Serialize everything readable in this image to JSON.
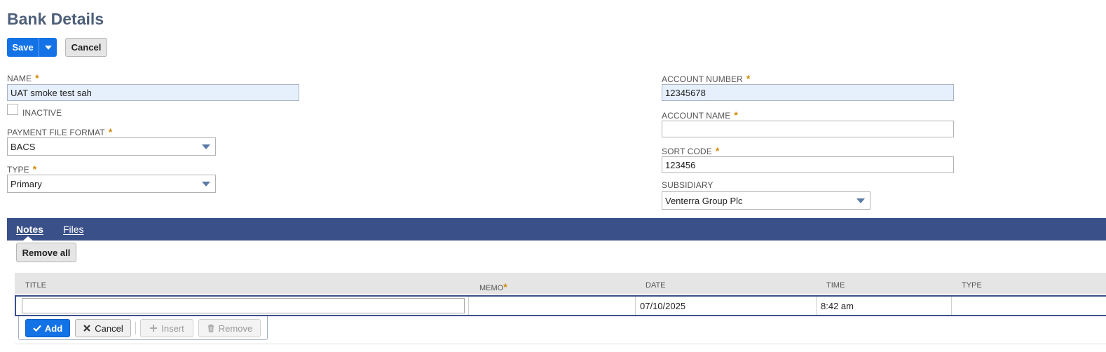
{
  "page": {
    "title": "Bank Details"
  },
  "toolbar": {
    "save_label": "Save",
    "cancel_label": "Cancel"
  },
  "form": {
    "name": {
      "label": "NAME",
      "value": "UAT smoke test sah"
    },
    "inactive": {
      "label": "INACTIVE",
      "checked": false
    },
    "payment_file_format": {
      "label": "PAYMENT FILE FORMAT",
      "value": "BACS"
    },
    "type": {
      "label": "TYPE",
      "value": "Primary"
    },
    "account_number": {
      "label": "ACCOUNT NUMBER",
      "value": "12345678"
    },
    "account_name": {
      "label": "ACCOUNT NAME",
      "value": ""
    },
    "sort_code": {
      "label": "SORT CODE",
      "value": "123456"
    },
    "subsidiary": {
      "label": "SUBSIDIARY",
      "value": "Venterra Group Plc"
    },
    "required_marker": "*"
  },
  "tabs": [
    {
      "label": "Notes",
      "active": true
    },
    {
      "label": "Files",
      "active": false
    }
  ],
  "notes": {
    "remove_all_label": "Remove all",
    "columns": [
      "TITLE",
      "MEMO",
      "DATE",
      "TIME",
      "TYPE"
    ],
    "row": {
      "title": "",
      "memo": "",
      "date": "07/10/2025",
      "time": "8:42 am",
      "type": ""
    },
    "actions": {
      "add": "Add",
      "cancel": "Cancel",
      "insert": "Insert",
      "remove": "Remove"
    }
  },
  "colors": {
    "primary": "#1272e6",
    "tabbar": "#3a5088",
    "title": "#4d5f79",
    "required": "#d08a00"
  }
}
